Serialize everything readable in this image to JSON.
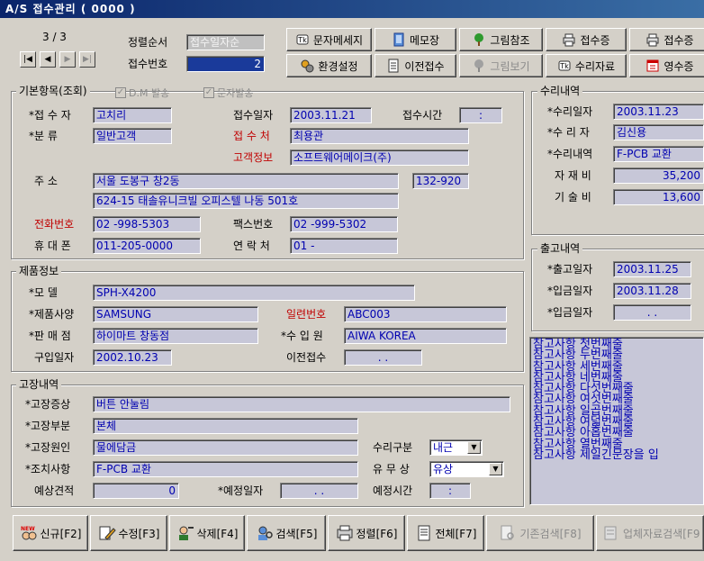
{
  "window": {
    "title": "A/S 접수관리 ( 0000 )"
  },
  "record": {
    "position": "3 / 3",
    "sort_label": "정렬순서",
    "sort_value": "접수일자순",
    "receipt_no_label": "접수번호",
    "receipt_no_value": "2"
  },
  "toolbar": {
    "row1": [
      {
        "label": "문자메세지",
        "icon": "message-icon",
        "enabled": true
      },
      {
        "label": "메모장",
        "icon": "notepad-icon",
        "enabled": true
      },
      {
        "label": "그림참조",
        "icon": "tree-icon",
        "enabled": true
      },
      {
        "label": "접수증",
        "icon": "printer-icon",
        "enabled": true
      },
      {
        "label": "접수증",
        "icon": "printer-icon",
        "enabled": true
      }
    ],
    "row2": [
      {
        "label": "환경설정",
        "icon": "settings-icon",
        "enabled": true
      },
      {
        "label": "이전접수",
        "icon": "document-icon",
        "enabled": true
      },
      {
        "label": "그림보기",
        "icon": "tree-icon",
        "enabled": false
      },
      {
        "label": "수리자료",
        "icon": "message-icon",
        "enabled": true
      },
      {
        "label": "영수증",
        "icon": "calendar-icon",
        "enabled": true
      }
    ]
  },
  "basic": {
    "title": "기본항목(조회)",
    "dm_label": "D.M 발송",
    "sms_label": "문자발송",
    "receiver_label": "*접 수 자",
    "receiver": "고치리",
    "receive_date_label": "접수일자",
    "receive_date": "2003.11.21",
    "receive_time_label": "접수시간",
    "receive_time": ":",
    "category_label": "*분    류",
    "category": "일반고객",
    "recv_place_label": "접 수 처",
    "recv_place": "최용관",
    "customer_label": "고객정보",
    "customer": "소프트웨어메이크(주)",
    "address_label": "주      소",
    "address1": "서울 도봉구 창2동",
    "zip": "132-920",
    "address2": "624-15 태솔유니크빌 오피스텔 나동 501호",
    "phone_label": "전화번호",
    "phone": "02  -998-5303",
    "fax_label": "팩스번호",
    "fax": "02  -999-5302",
    "mobile_label": "휴 대 폰",
    "mobile": "011-205-0000",
    "contact_label": "연 락 처",
    "contact": "01 -"
  },
  "product": {
    "title": "제품정보",
    "model_label": "*모    델",
    "model": "SPH-X4200",
    "spec_label": "*제품사양",
    "spec": "SAMSUNG",
    "serial_label": "일련번호",
    "serial": "ABC003",
    "seller_label": "*판 매 점",
    "seller": "하이마트 창동점",
    "importer_label": "*수 입 원",
    "importer": "AIWA KOREA",
    "purchase_label": "구입일자",
    "purchase": "2002.10.23",
    "prev_label": "이전접수",
    "prev": ". ."
  },
  "fault": {
    "title": "고장내역",
    "symptom_label": "*고장증상",
    "symptom": "버튼 안눌림",
    "part_label": "*고장부분",
    "part": "본체",
    "cause_label": "*고장원인",
    "cause": "물에담금",
    "repair_type_label": "수리구분",
    "repair_type": "내근",
    "action_label": "*조치사항",
    "action": "F-PCB 교환",
    "paid_label": "유 무 상",
    "paid": "유상",
    "estimate_label": "예상견적",
    "estimate": "0",
    "sched_date_label": "*예정일자",
    "sched_date": ". .",
    "sched_time_label": "예정시간",
    "sched_time": ":"
  },
  "repair": {
    "title": "수리내역",
    "date_label": "*수리일자",
    "date": "2003.11.23",
    "person_label": "*수 리 자",
    "person": "김신용",
    "detail_label": "*수리내역",
    "detail": "F-PCB 교환",
    "material_label": "자 재 비",
    "material": "35,200",
    "tech_label": "기 술 비",
    "tech": "13,600"
  },
  "shipping": {
    "title": "출고내역",
    "out_label": "*출고일자",
    "out_date": "2003.11.25",
    "in_label": "*입금일자",
    "in_date": "2003.11.28",
    "in2_label": "*입금일자",
    "in2_date": ". ."
  },
  "notes": [
    "참고사항 첫번째줄",
    "참고사항 두번째줄",
    "참고사항 세번째줄",
    "참고사항 네번째줄",
    "참고사항 다섯번째줄",
    "참고사항 여섯번째줄",
    "참고사항 일곱번째줄",
    "참고사항 여덟번째줄",
    "참고사항 아홉번째줄",
    "참고사항 열번째줄",
    "참고사항 제일긴문장을 입"
  ],
  "footer": [
    {
      "label": "신규[F2]",
      "icon": "new-icon",
      "enabled": true,
      "badge": "NEW"
    },
    {
      "label": "수정[F3]",
      "icon": "edit-icon",
      "enabled": true
    },
    {
      "label": "삭제[F4]",
      "icon": "delete-user-icon",
      "enabled": true
    },
    {
      "label": "검색[F5]",
      "icon": "search-user-icon",
      "enabled": true
    },
    {
      "label": "정렬[F6]",
      "icon": "sort-icon",
      "enabled": true
    },
    {
      "label": "전체[F7]",
      "icon": "list-icon",
      "enabled": true
    },
    {
      "label": "기존검색[F8]",
      "icon": "search-doc-icon",
      "enabled": false
    },
    {
      "label": "업체자료검색[F9",
      "icon": "company-icon",
      "enabled": false
    }
  ]
}
